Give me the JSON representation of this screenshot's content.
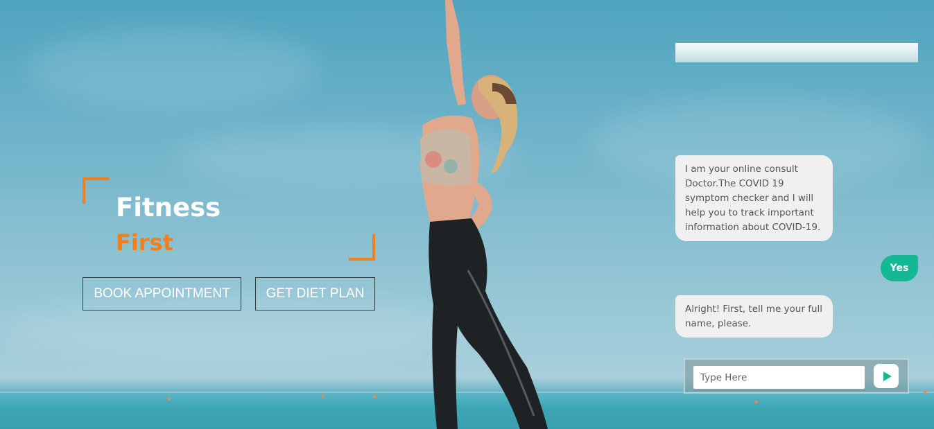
{
  "hero": {
    "title": "Fitness",
    "subtitle": "First",
    "book_button": "BOOK APPOINTMENT",
    "diet_button": "GET DIET PLAN"
  },
  "chat": {
    "messages": [
      {
        "from": "bot",
        "text": "I am your online consult Doctor.The COVID 19 symptom checker and I will help you to track important information about COVID-19."
      },
      {
        "from": "user",
        "text": "Yes"
      },
      {
        "from": "bot",
        "text": "Alright! First, tell me your full name, please."
      }
    ],
    "input_placeholder": "Type Here",
    "send_icon": "send-icon"
  },
  "colors": {
    "accent_orange": "#f07f1e",
    "chat_green": "#14b894",
    "bubble_bg": "#f0f0f0"
  }
}
